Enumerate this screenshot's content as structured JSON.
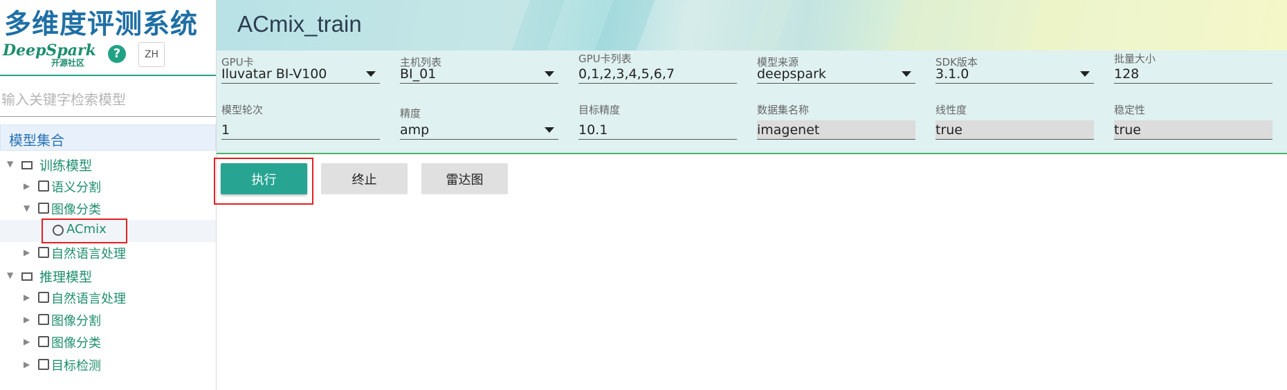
{
  "sidebar": {
    "app_title": "多维度评测系统",
    "brand_name": "DeepSpark",
    "brand_sub": "开源社区",
    "help_icon": "?",
    "lang_button": "ZH",
    "search_placeholder": "输入关键字检索模型",
    "tree": {
      "root": "模型集合",
      "train": {
        "label": "训练模型",
        "children": [
          "语义分割",
          "图像分类",
          "自然语言处理"
        ],
        "selected_leaf": "ACmix"
      },
      "infer": {
        "label": "推理模型",
        "children": [
          "自然语言处理",
          "图像分割",
          "图像分类",
          "目标检测"
        ]
      }
    }
  },
  "main": {
    "title": "ACmix_train",
    "fields": [
      {
        "label": "GPU卡",
        "value": "Iluvatar BI-V100",
        "type": "select"
      },
      {
        "label": "主机列表",
        "value": "BI_01",
        "type": "select"
      },
      {
        "label": "GPU卡列表",
        "value": "0,1,2,3,4,5,6,7",
        "type": "text"
      },
      {
        "label": "模型来源",
        "value": "deepspark",
        "type": "select"
      },
      {
        "label": "SDK版本",
        "value": "3.1.0",
        "type": "select"
      },
      {
        "label": "批量大小",
        "value": "128",
        "type": "text"
      },
      {
        "label": "模型轮次",
        "value": "1",
        "type": "text"
      },
      {
        "label": "精度",
        "value": "amp",
        "type": "select"
      },
      {
        "label": "目标精度",
        "value": "10.1",
        "type": "text"
      },
      {
        "label": "数据集名称",
        "value": "imagenet",
        "type": "readonly"
      },
      {
        "label": "线性度",
        "value": "true",
        "type": "readonly"
      },
      {
        "label": "稳定性",
        "value": "true",
        "type": "readonly"
      }
    ],
    "buttons": {
      "run": "执行",
      "stop": "终止",
      "radar": "雷达图"
    }
  },
  "colors": {
    "accent": "#27a592",
    "title_blue": "#1f6fa5",
    "tree_green": "#1e8e6e",
    "highlight": "#e02020"
  }
}
